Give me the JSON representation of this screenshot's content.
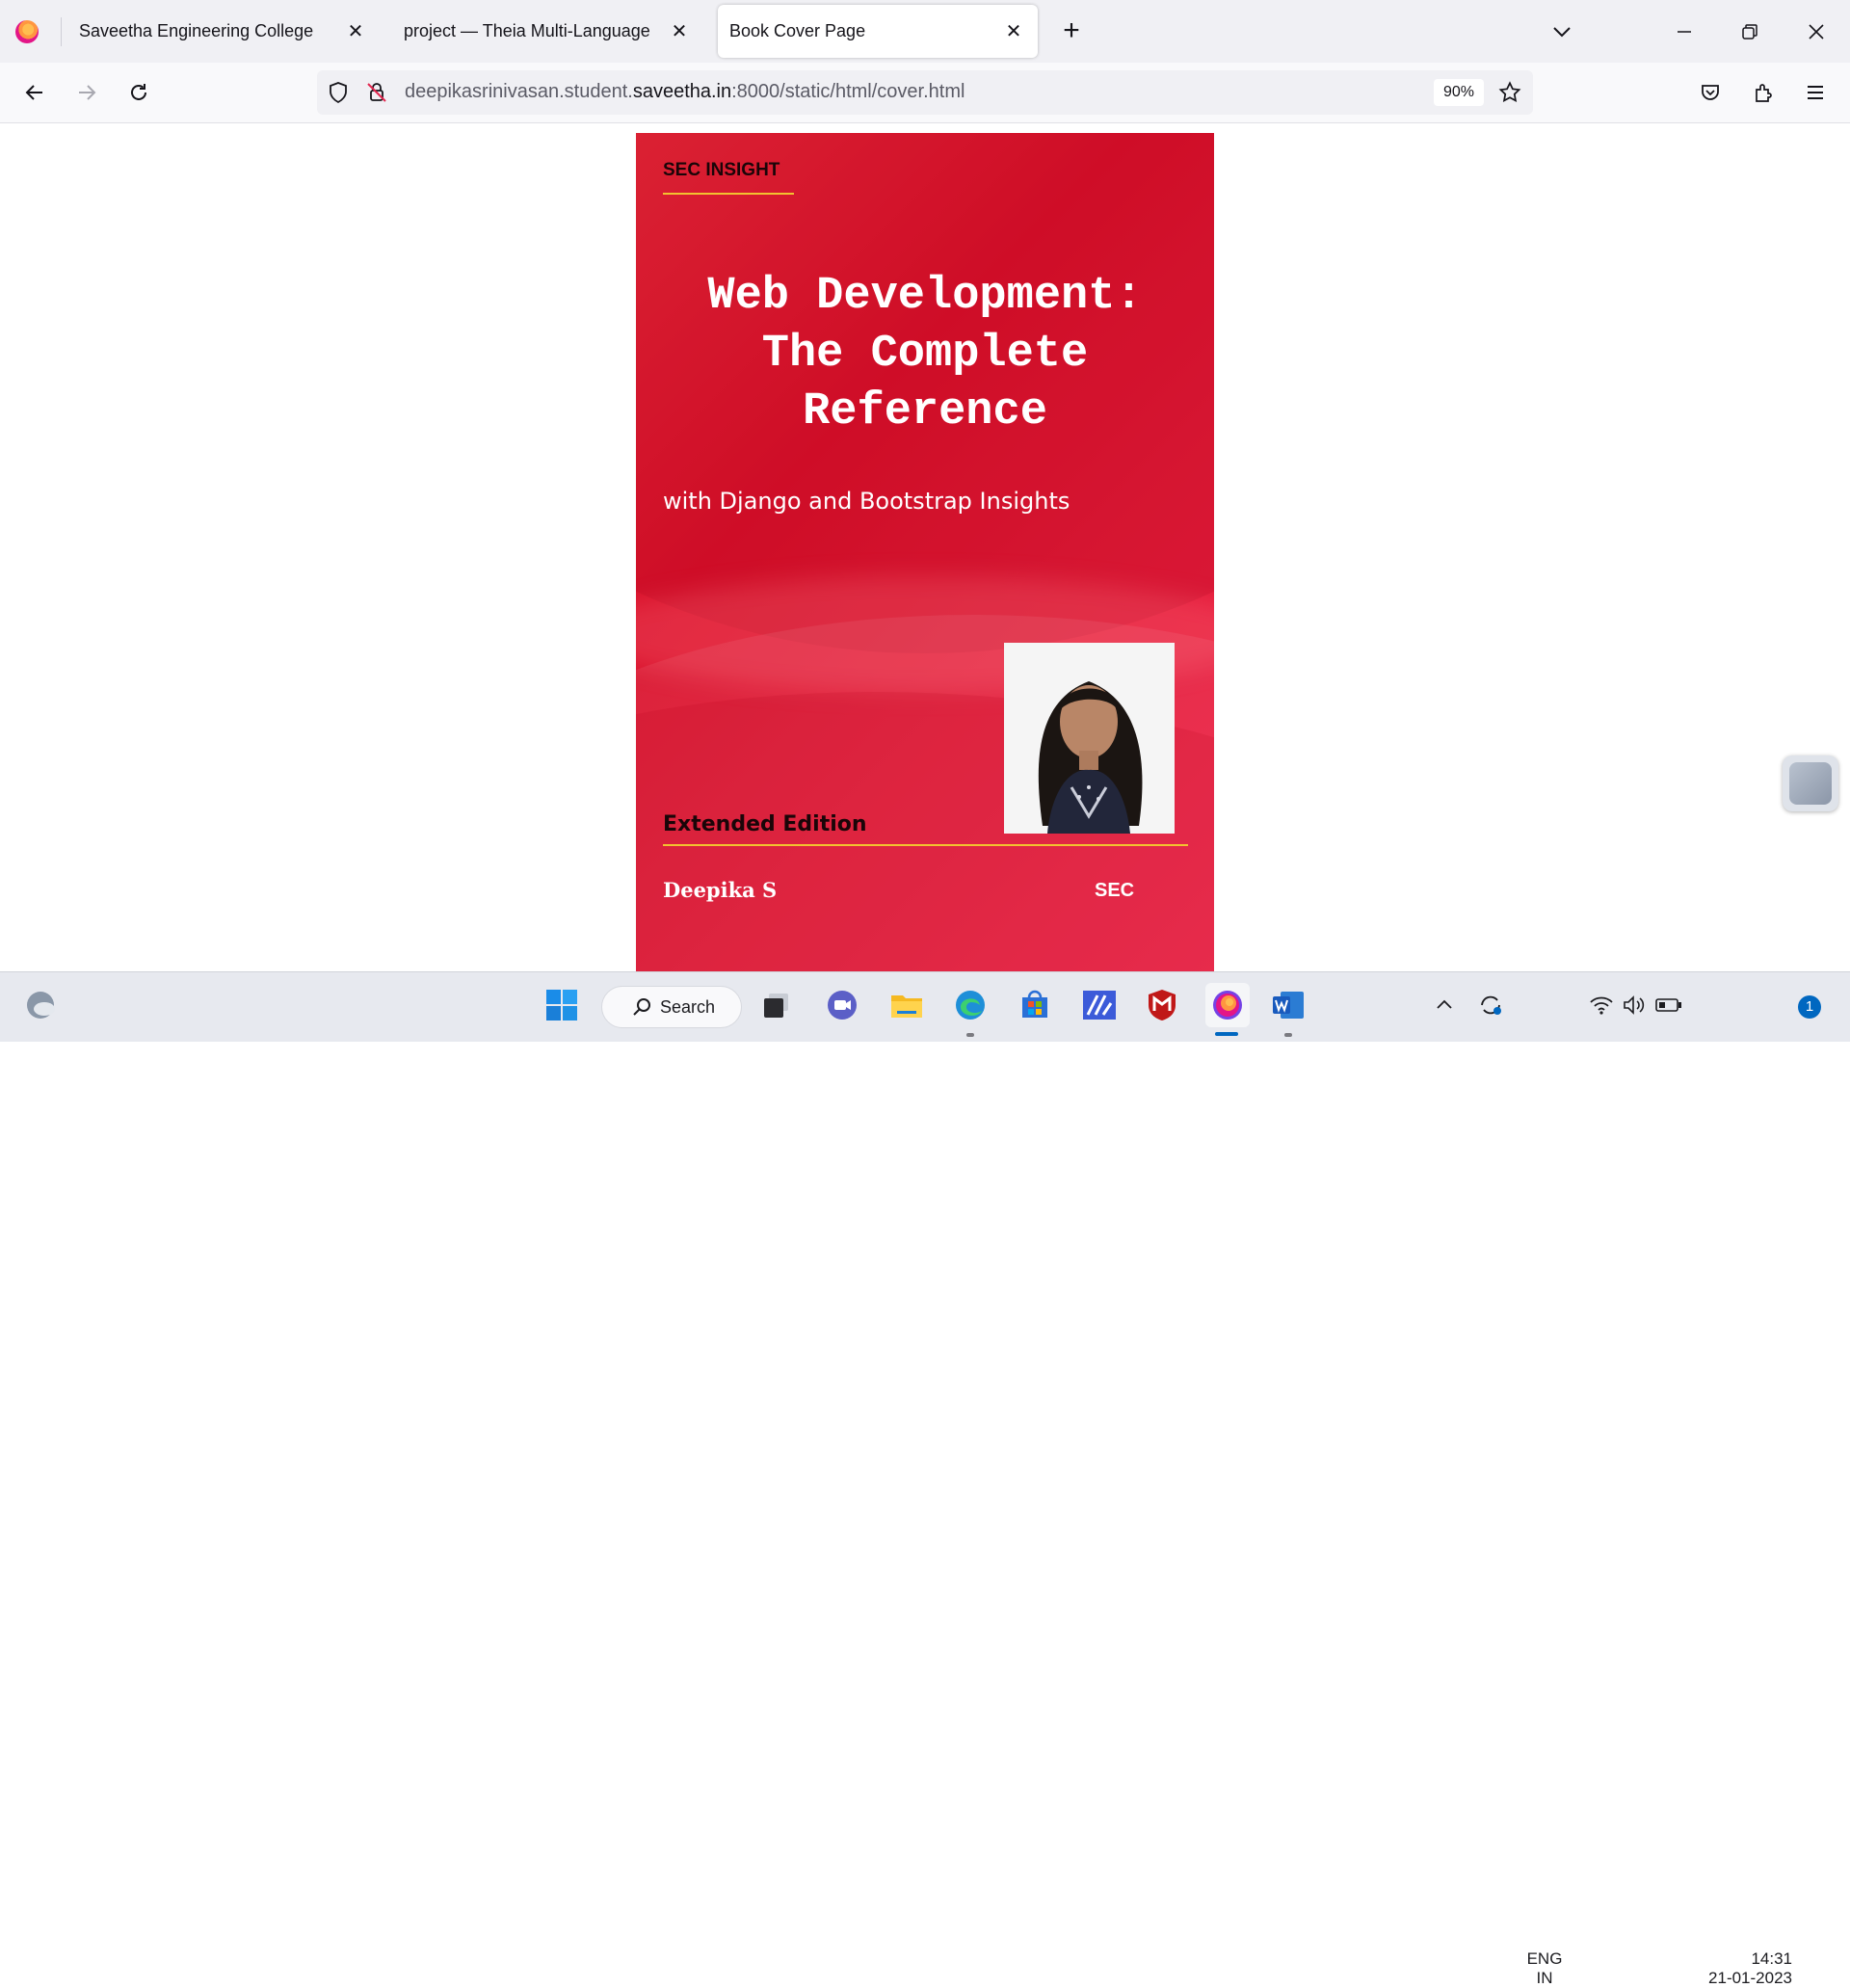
{
  "browser": {
    "tabs": [
      {
        "label": "Saveetha Engineering College",
        "active": false
      },
      {
        "label": "project — Theia Multi-Language Ex",
        "active": false
      },
      {
        "label": "Book Cover Page",
        "active": true
      }
    ],
    "url_prefix": "deepikasrinivasan.student.",
    "url_host": "saveetha.in",
    "url_suffix": ":8000/static/html/cover.html",
    "zoom": "90%"
  },
  "cover": {
    "series": "SEC INSIGHT",
    "title_line1": "Web Development:",
    "title_line2": "The Complete",
    "title_line3": "Reference",
    "subtitle": "with Django and Bootstrap Insights",
    "edition": "Extended Edition",
    "author": "Deepika S",
    "publisher": "SEC",
    "colors": {
      "background": "#d9112b",
      "accent_line": "#f2c230"
    }
  },
  "taskbar": {
    "search_label": "Search",
    "apps": [
      "widgets-icon",
      "windows-start-icon",
      "task-view-icon",
      "teams-chat-icon",
      "file-explorer-icon",
      "edge-icon",
      "microsoft-store-icon",
      "visual-studio-icon",
      "mcafee-icon",
      "firefox-icon",
      "word-icon"
    ],
    "language_line1": "ENG",
    "language_line2": "IN",
    "time": "14:31",
    "date": "21-01-2023",
    "notification_count": "1"
  }
}
